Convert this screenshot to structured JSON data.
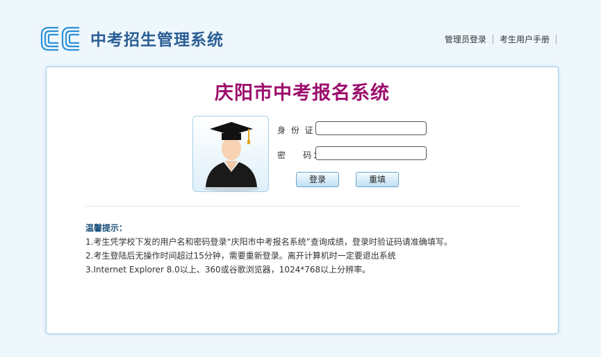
{
  "header": {
    "site_title": "中考招生管理系统",
    "links": [
      "管理员登录",
      "考生用户手册"
    ]
  },
  "card": {
    "title": "庆阳市中考报名系统",
    "form": {
      "id_label": "身 份 证：",
      "password_label": "密    码：",
      "id_value": "",
      "password_value": "",
      "login_button": "登录",
      "reset_button": "重填"
    },
    "tips": {
      "title": "温馨提示：",
      "items": [
        "1.考生凭学校下发的用户名和密码登录“庆阳市中考报名系统”查询成绩，登录时验证码请准确填写。",
        "2.考生登陆后无操作时间超过15分钟，需要重新登录。离开计算机时一定要退出系统",
        "3.Internet Explorer 8.0以上、360或谷歌浏览器，1024*768以上分辨率。"
      ]
    }
  },
  "colors": {
    "brand_blue": "#2a5d94",
    "title_magenta": "#9c0e6c",
    "background": "#eef7fc"
  }
}
